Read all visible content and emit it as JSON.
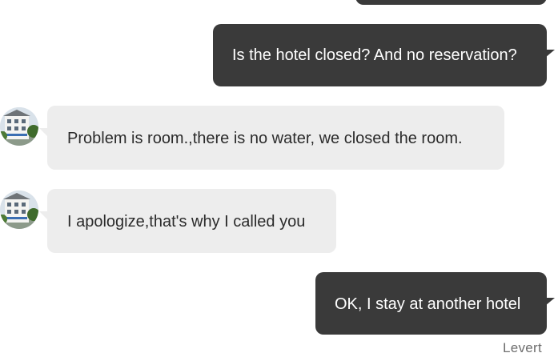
{
  "messages": [
    {
      "direction": "outgoing",
      "text": ""
    },
    {
      "direction": "outgoing",
      "text": "Is the hotel closed? And no reservation?"
    },
    {
      "direction": "incoming",
      "text": "Problem is room.,there is no water, we  closed the room."
    },
    {
      "direction": "incoming",
      "text": "I apologize,that's why I called you"
    },
    {
      "direction": "outgoing",
      "text": "OK, I stay at another hotel"
    }
  ],
  "status": "Levert",
  "colors": {
    "outgoing_bubble": "#3a3a3a",
    "incoming_bubble": "#ededed",
    "outgoing_text": "#ffffff",
    "incoming_text": "#2b2b2b",
    "background": "#ffffff"
  },
  "icons": {
    "avatar": "hotel-building-avatar-icon"
  }
}
